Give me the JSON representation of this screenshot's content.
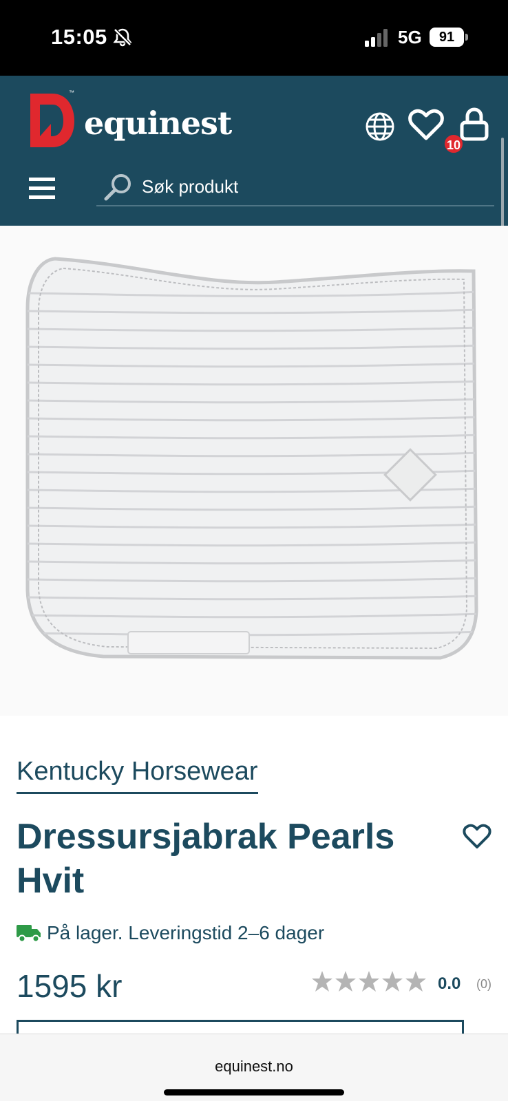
{
  "status_bar": {
    "time": "15:05",
    "network": "5G",
    "battery": "91",
    "icons": [
      "bell-slash-icon",
      "signal-icon",
      "battery-icon"
    ]
  },
  "header": {
    "logo_text": "equinest",
    "logo_tm": "™",
    "cart_badge": "10",
    "search_placeholder": "Søk produkt",
    "icons": [
      "globe-icon",
      "heart-icon",
      "lock-icon",
      "menu-icon",
      "search-icon"
    ]
  },
  "product": {
    "image_alt": "White quilted dressage saddle pad",
    "brand": "Kentucky Horsewear",
    "title": "Dressursjabrak Pearls Hvit",
    "stock": "På lager. Leveringstid 2–6 dager",
    "price": "1595 kr",
    "rating": {
      "value": "0.0",
      "count": "(0)",
      "stars_filled": 0,
      "stars_total": 5
    }
  },
  "browser": {
    "url": "equinest.no"
  },
  "colors": {
    "brand_navy": "#1c4a5e",
    "logo_red": "#e0282e",
    "badge_red": "#e0282e",
    "stock_green": "#2e9a47",
    "star_gray": "#b4b4b4"
  }
}
